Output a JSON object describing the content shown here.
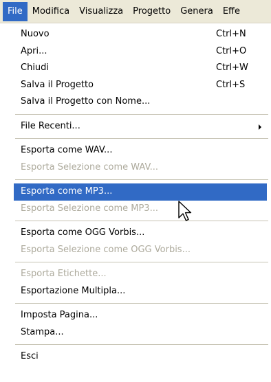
{
  "menubar": {
    "items": [
      "File",
      "Modifica",
      "Visualizza",
      "Progetto",
      "Genera",
      "Effe"
    ],
    "active_index": 0
  },
  "file_menu": {
    "nuovo": {
      "label": "Nuovo",
      "shortcut": "Ctrl+N"
    },
    "apri": {
      "label": "Apri...",
      "shortcut": "Ctrl+O"
    },
    "chiudi": {
      "label": "Chiudi",
      "shortcut": "Ctrl+W"
    },
    "salva": {
      "label": "Salva il Progetto",
      "shortcut": "Ctrl+S"
    },
    "salva_nome": {
      "label": "Salva il Progetto con Nome..."
    },
    "file_recenti": {
      "label": "File Recenti..."
    },
    "esporta_wav": {
      "label": "Esporta come WAV..."
    },
    "esporta_sel_wav": {
      "label": "Esporta Selezione come WAV...",
      "enabled": false
    },
    "esporta_mp3": {
      "label": "Esporta come MP3...",
      "highlighted": true
    },
    "esporta_sel_mp3": {
      "label": "Esporta Selezione come MP3...",
      "enabled": false
    },
    "esporta_ogg": {
      "label": "Esporta come OGG Vorbis..."
    },
    "esporta_sel_ogg": {
      "label": "Esporta Selezione come OGG Vorbis...",
      "enabled": false
    },
    "esporta_etichette": {
      "label": "Esporta Etichette...",
      "enabled": false
    },
    "esportazione_multipla": {
      "label": "Esportazione Multipla..."
    },
    "imposta_pagina": {
      "label": "Imposta Pagina..."
    },
    "stampa": {
      "label": "Stampa..."
    },
    "esci": {
      "label": "Esci"
    }
  },
  "colors": {
    "highlight": "#316ac5",
    "menubar_bg": "#ece9d8",
    "disabled_text": "#adaa9c"
  },
  "icons": {
    "submenu": "right-triangle",
    "cursor": "mouse-pointer-arrow"
  }
}
